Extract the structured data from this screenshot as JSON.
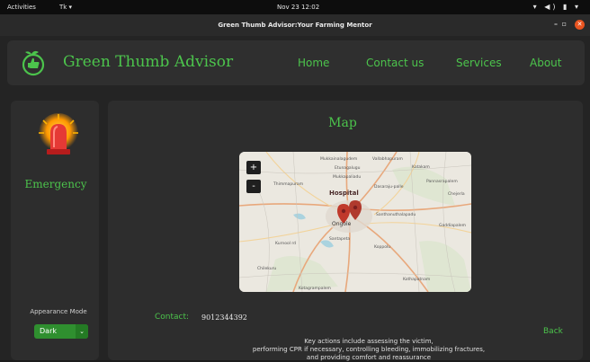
{
  "system": {
    "activities": "Activities",
    "app_menu": "Tk ▾",
    "clock": "Nov 23  12:02",
    "tray": "▾ ◀) ▮ ▾"
  },
  "window": {
    "title": "Green Thumb Advisor:Your Farming Mentor",
    "minimize": "–",
    "maximize": "▫",
    "close": "✕"
  },
  "header": {
    "brand": "Green Thumb Advisor",
    "nav": [
      "Home",
      "Contact us",
      "Services",
      "About"
    ]
  },
  "sidebar": {
    "emergency": "Emergency",
    "appearance_label": "Appearance Mode",
    "appearance_value": "Dark",
    "dropdown_arrow": "⌄"
  },
  "main": {
    "title": "Map",
    "zoom_in": "+",
    "zoom_out": "-",
    "map_labels": {
      "hospital": "Hospital",
      "city": "Ongole",
      "places": [
        "Mukkainalagudem",
        "Thimmapuram",
        "Vallabhapuram",
        "Katakam",
        "Dasaraju-palle",
        "Etunagalugu",
        "Mukkapaliadu",
        "Pannasrapalem",
        "Chejerla",
        "Santhanuthalapadu",
        "Gaddiapalem",
        "Koppolu",
        "Santapeta",
        "Kurnool rd",
        "Chilekuru",
        "Kothapatnam",
        "Kotagrampalem"
      ]
    },
    "contact_label": "Contact:",
    "contact_value": "9012344392",
    "back": "Back",
    "description": [
      "Key actions include assessing the victim,",
      "performing CPR if necessary, controlling bleeding, immobilizing fractures,",
      "and providing comfort and reassurance"
    ]
  },
  "colors": {
    "accent": "#4cc44c",
    "panel": "#2d2d2d",
    "background": "#242424",
    "marker": "#c0392b"
  }
}
